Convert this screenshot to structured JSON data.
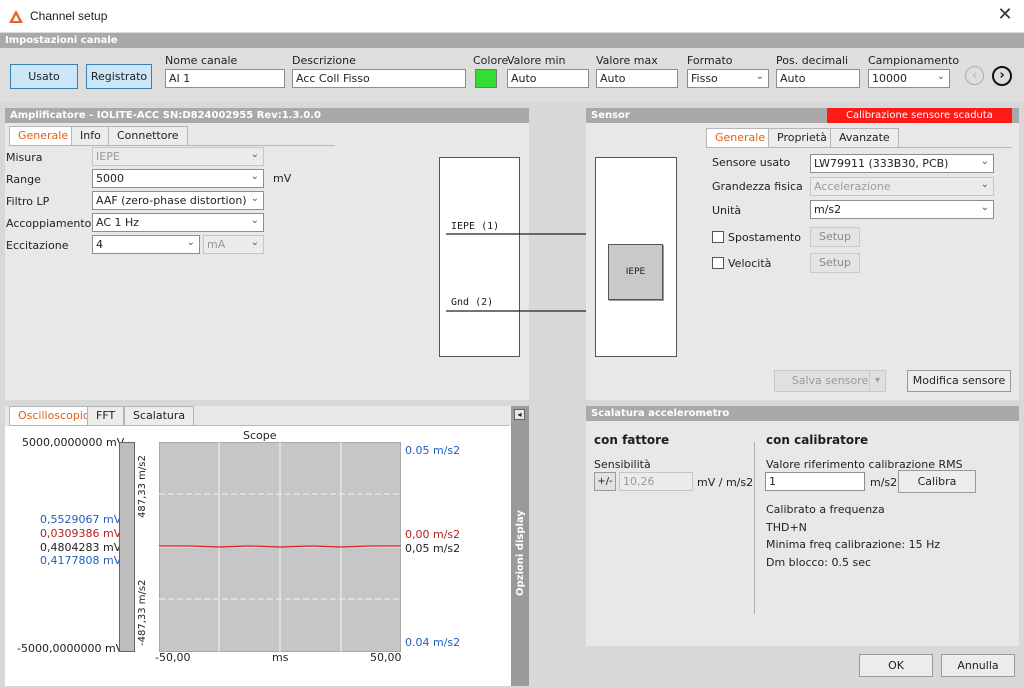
{
  "window": {
    "title": "Channel setup",
    "close_icon": "close-icon",
    "app_icon": "dewesoft-logo-icon"
  },
  "channel_settings": {
    "header": "Impostazioni canale",
    "used_button": "Usato",
    "recorded_button": "Registrato",
    "labels": {
      "name": "Nome canale",
      "description": "Descrizione",
      "color": "Colore",
      "min": "Valore min",
      "max": "Valore max",
      "format": "Formato",
      "decimals": "Pos. decimali",
      "sampling": "Campionamento"
    },
    "values": {
      "name": "AI 1",
      "description": "Acc Coll Fisso",
      "color": "#33dd33",
      "min": "Auto",
      "max": "Auto",
      "format": "Fisso",
      "decimals": "Auto",
      "sampling": "10000"
    }
  },
  "amplifier": {
    "header": "Amplificatore - IOLITE-ACC  SN:D824002955 Rev:1.3.0.0",
    "tabs": [
      "Generale",
      "Info",
      "Connettore"
    ],
    "rows": [
      {
        "label": "Misura",
        "value": "IEPE",
        "disabled": true
      },
      {
        "label": "Range",
        "value": "5000",
        "unit": "mV"
      },
      {
        "label": "Filtro LP",
        "value": "AAF (zero-phase distortion)"
      },
      {
        "label": "Accoppiamento",
        "value": "AC 1 Hz"
      },
      {
        "label": "Eccitazione",
        "value": "4",
        "unit_value": "mA"
      }
    ],
    "diagram": {
      "pin1": "IEPE (1)",
      "pin2": "Gnd (2)"
    }
  },
  "sensor": {
    "header": "Sensor",
    "warning": "Calibrazione sensore scaduta",
    "tabs": [
      "Generale",
      "Proprietà",
      "Avanzate"
    ],
    "rows": {
      "sensor_used": {
        "label": "Sensore usato",
        "value": "LW79911 (333B30, PCB)"
      },
      "physical_quantity": {
        "label": "Grandezza fisica",
        "value": "Accelerazione"
      },
      "unit": {
        "label": "Unità",
        "value": "m/s2"
      },
      "displacement": {
        "label": "Spostamento",
        "button": "Setup"
      },
      "velocity": {
        "label": "Velocità",
        "button": "Setup"
      }
    },
    "diagram_label": "IEPE",
    "save_button": "Salva sensore",
    "edit_button": "Modifica sensore"
  },
  "scope": {
    "tabs": [
      "Oscilloscopio",
      "FFT",
      "Scalatura"
    ],
    "title": "Scope",
    "display_options": "Opzioni display",
    "y_top_left": "5000,0000000 mV",
    "y_bottom_left": "-5000,0000000 mV",
    "y_top_right": "0.05 m/s2",
    "y_bottom_right": "0.04 m/s2",
    "bar_top": "487,33 m/s2",
    "bar_bottom": "-487,33 m/s2",
    "values_left": [
      {
        "text": "0,5529067 mV",
        "color": "#1f5fbf"
      },
      {
        "text": "0,0309386 mV",
        "color": "#b22222"
      },
      {
        "text": "0,4804283 mV",
        "color": "#222222"
      },
      {
        "text": "0,4177808 mV",
        "color": "#1f5fbf"
      }
    ],
    "values_right": [
      {
        "text": "0,00 m/s2",
        "color": "#b22222"
      },
      {
        "text": "0,05 m/s2",
        "color": "#222222"
      }
    ],
    "x_axis": {
      "min": "-50,00",
      "unit": "ms",
      "max": "50,00"
    }
  },
  "scaling": {
    "header": "Scalatura accelerometro",
    "factor_title": "con fattore",
    "sensitivity_label": "Sensibilità",
    "sensitivity_sign": "+/-",
    "sensitivity_value": "10,26",
    "sensitivity_unit": "mV / m/s2",
    "calibrator_title": "con calibratore",
    "rms_label": "Valore riferimento calibrazione RMS",
    "rms_value": "1",
    "rms_unit": "m/s2",
    "calibrate_button": "Calibra",
    "calib_freq": "Calibrato a frequenza",
    "thd": "THD+N",
    "min_freq": "Minima freq calibrazione: 15 Hz",
    "block_dur": "Dm blocco: 0.5 sec"
  },
  "footer": {
    "ok": "OK",
    "cancel": "Annulla"
  }
}
